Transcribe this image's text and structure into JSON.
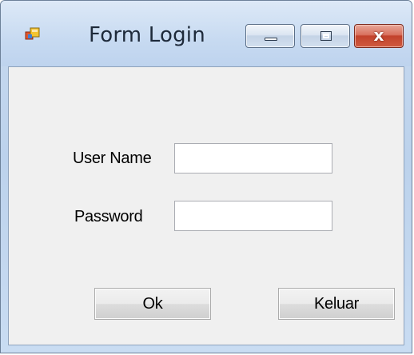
{
  "window": {
    "title": "Form Login",
    "icon": "windows-form-icon"
  },
  "caption_buttons": {
    "minimize": "minimize-icon",
    "maximize": "maximize-icon",
    "close": "close-icon",
    "close_glyph": "x"
  },
  "form": {
    "username_label": "User Name",
    "username_value": "",
    "password_label": "Password",
    "password_value": ""
  },
  "buttons": {
    "ok_label": "Ok",
    "exit_label": "Keluar"
  },
  "colors": {
    "titlebar": "#c8daf0",
    "client_bg": "#f0f0f0",
    "close_button": "#c2422b"
  }
}
